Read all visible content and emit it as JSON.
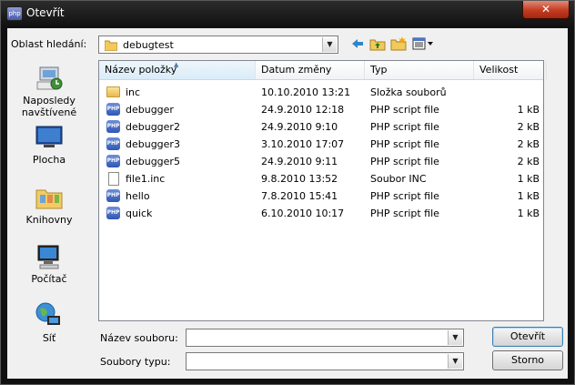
{
  "window": {
    "title": "Otevřít",
    "app_icon": "php-ide-icon",
    "close_glyph": "✕"
  },
  "toolbar": {
    "lookin_label": "Oblast hledání:",
    "lookin_value": "debugtest",
    "icons": [
      "back-arrow-icon",
      "up-folder-icon",
      "new-folder-icon",
      "view-menu-icon"
    ]
  },
  "places": [
    {
      "label": "Naposledy navštívené",
      "icon": "recent-places-icon"
    },
    {
      "label": "Plocha",
      "icon": "desktop-icon"
    },
    {
      "label": "Knihovny",
      "icon": "libraries-icon"
    },
    {
      "label": "Počítač",
      "icon": "computer-icon"
    },
    {
      "label": "Síť",
      "icon": "network-icon"
    }
  ],
  "columns": [
    "Název položky",
    "Datum změny",
    "Typ",
    "Velikost"
  ],
  "files": [
    {
      "name": "inc",
      "date": "10.10.2010 13:21",
      "type": "Složka souborů",
      "size": "",
      "icon": "folder"
    },
    {
      "name": "debugger",
      "date": "24.9.2010 12:18",
      "type": "PHP script file",
      "size": "1 kB",
      "icon": "php"
    },
    {
      "name": "debugger2",
      "date": "24.9.2010 9:10",
      "type": "PHP script file",
      "size": "2 kB",
      "icon": "php"
    },
    {
      "name": "debugger3",
      "date": "3.10.2010 17:07",
      "type": "PHP script file",
      "size": "2 kB",
      "icon": "php"
    },
    {
      "name": "debugger5",
      "date": "24.9.2010 9:11",
      "type": "PHP script file",
      "size": "2 kB",
      "icon": "php"
    },
    {
      "name": "file1.inc",
      "date": "9.8.2010 13:52",
      "type": "Soubor INC",
      "size": "1 kB",
      "icon": "doc"
    },
    {
      "name": "hello",
      "date": "7.8.2010 15:41",
      "type": "PHP script file",
      "size": "1 kB",
      "icon": "php"
    },
    {
      "name": "quick",
      "date": "6.10.2010 10:17",
      "type": "PHP script file",
      "size": "1 kB",
      "icon": "php"
    }
  ],
  "filename_label": "Název souboru:",
  "filename_value": "",
  "filetype_label": "Soubory typu:",
  "filetype_value": "",
  "buttons": {
    "open": "Otevřít",
    "cancel": "Storno"
  },
  "colors": {
    "title_bg": "#1a1a1a",
    "close": "#c23b21",
    "client_bg": "#f0f0f0"
  }
}
